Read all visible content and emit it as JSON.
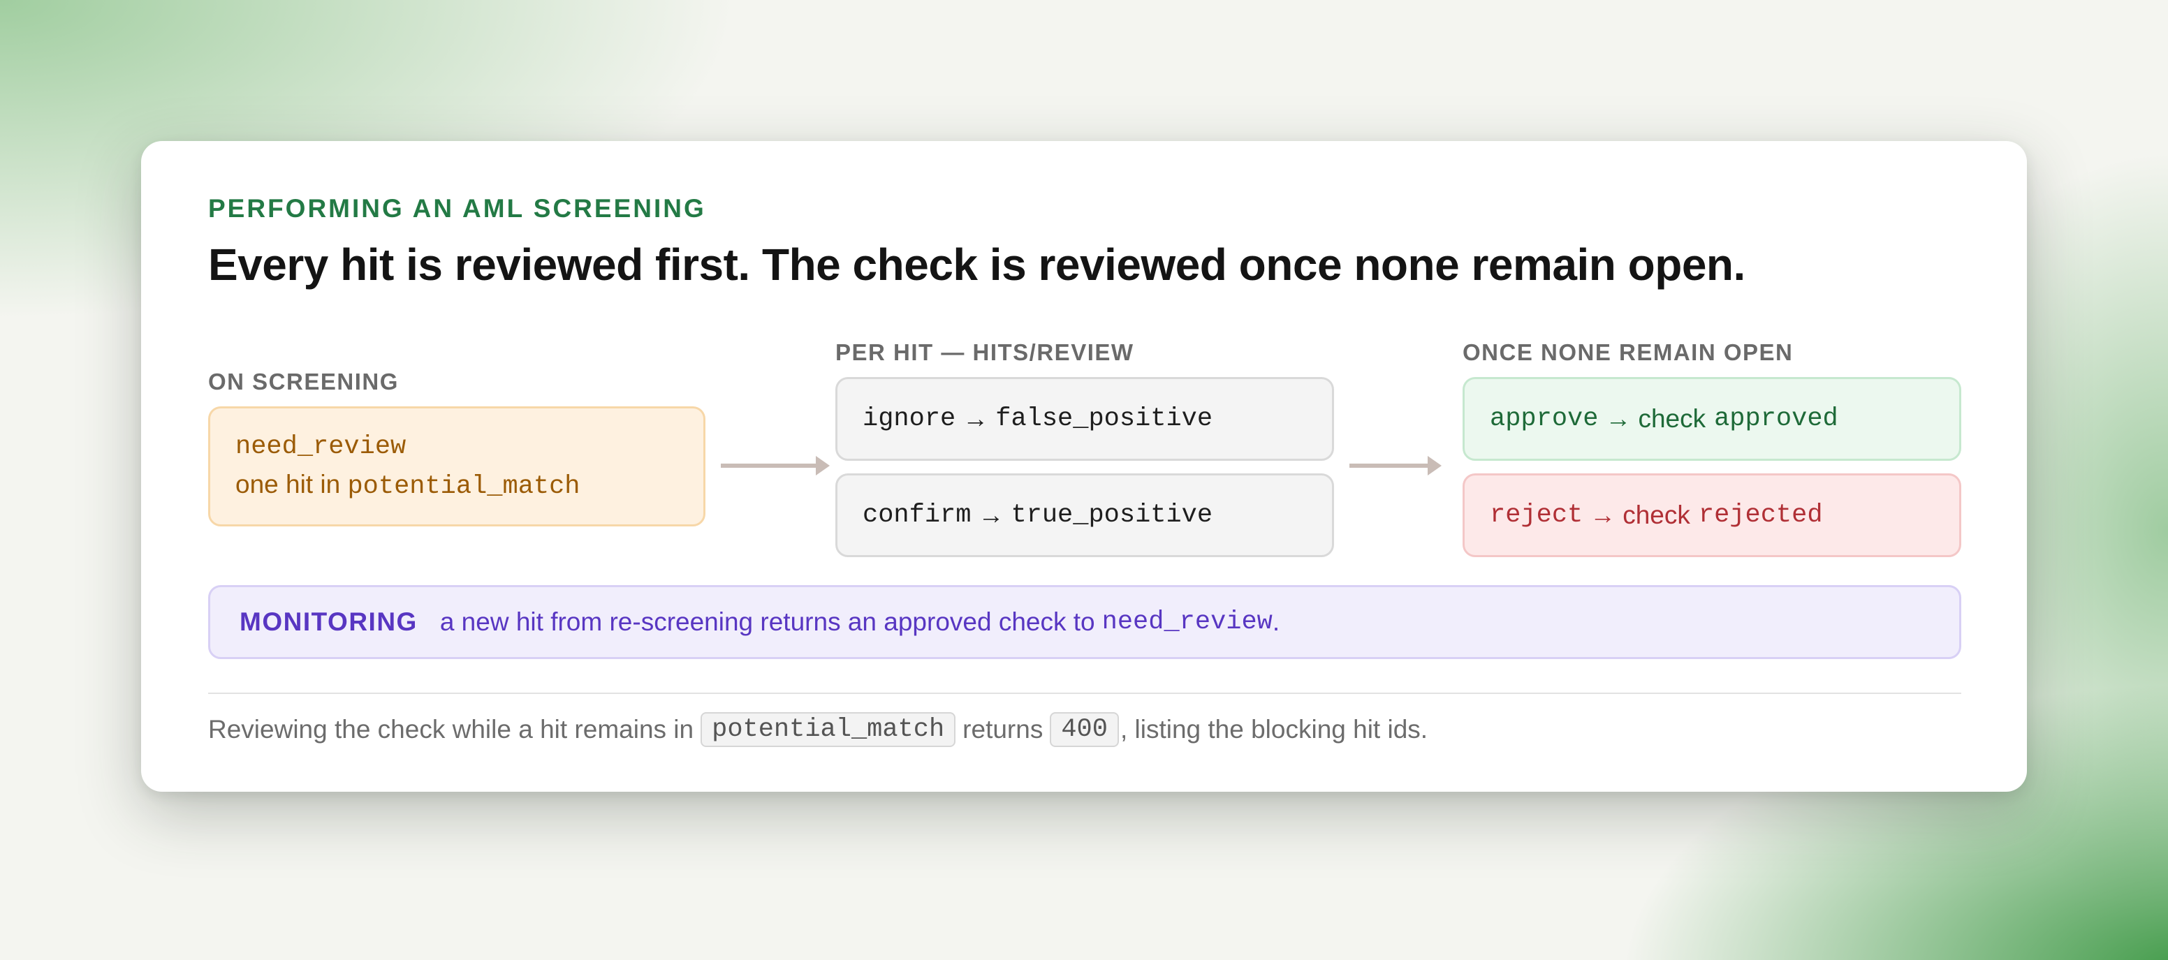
{
  "eyebrow": "PERFORMING AN AML SCREENING",
  "headline": "Every hit is reviewed first. The check is reviewed once none remain open.",
  "columns": {
    "screening": {
      "label": "ON SCREENING",
      "status": "need_review",
      "line_text": "one hit in ",
      "line_code": "potential_match"
    },
    "per_hit": {
      "label": "PER HIT — HITS/REVIEW",
      "ignore": {
        "action": "ignore",
        "arrow": "→",
        "result": "false_positive"
      },
      "confirm": {
        "action": "confirm",
        "arrow": "→",
        "result": "true_positive"
      }
    },
    "final": {
      "label": "ONCE NONE REMAIN OPEN",
      "approve": {
        "action": "approve",
        "arrow": "→",
        "text": "check",
        "result": "approved"
      },
      "reject": {
        "action": "reject",
        "arrow": "→",
        "text": "check",
        "result": "rejected"
      }
    }
  },
  "monitoring": {
    "tag": "MONITORING",
    "text": "a new hit from re-screening returns an approved check to ",
    "code": "need_review",
    "end": "."
  },
  "footnote": {
    "text1": "Reviewing the check while a hit remains in",
    "code1": "potential_match",
    "text2": "returns",
    "code2": "400",
    "text3": ", listing the blocking hit ids."
  }
}
